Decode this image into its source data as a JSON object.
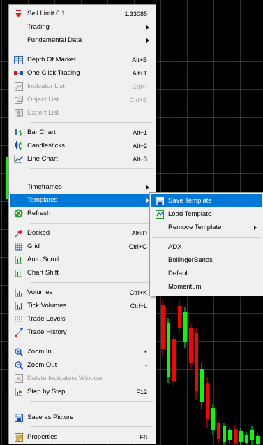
{
  "menu": {
    "sell_limit": {
      "label": "Sell Limit 0.1",
      "price": "1.33085"
    },
    "trading": "Trading",
    "fundamental_data": "Fundamental Data",
    "depth_of_market": {
      "label": "Depth Of Market",
      "shortcut": "Alt+B"
    },
    "one_click_trading": {
      "label": "One Click Trading",
      "shortcut": "Alt+T"
    },
    "indicator_list": {
      "label": "Indicator List",
      "shortcut": "Ctrl+I"
    },
    "object_list": {
      "label": "Object List",
      "shortcut": "Ctrl+B"
    },
    "expert_list": {
      "label": "Expert List"
    },
    "bar_chart": {
      "label": "Bar Chart",
      "shortcut": "Alt+1"
    },
    "candlesticks": {
      "label": "Candlesticks",
      "shortcut": "Alt+2"
    },
    "line_chart": {
      "label": "Line Chart",
      "shortcut": "Alt+3"
    },
    "timeframes": "Timeframes",
    "templates": "Templates",
    "refresh": "Refresh",
    "docked": {
      "label": "Docked",
      "shortcut": "Alt+D"
    },
    "grid": {
      "label": "Grid",
      "shortcut": "Ctrl+G"
    },
    "auto_scroll": {
      "label": "Auto Scroll"
    },
    "chart_shift": {
      "label": "Chart Shift"
    },
    "volumes": {
      "label": "Volumes",
      "shortcut": "Ctrl+K"
    },
    "tick_volumes": {
      "label": "Tick Volumes",
      "shortcut": "Ctrl+L"
    },
    "trade_levels": {
      "label": "Trade Levels"
    },
    "trade_history": {
      "label": "Trade History"
    },
    "zoom_in": {
      "label": "Zoom In",
      "shortcut": "+"
    },
    "zoom_out": {
      "label": "Zoom Out",
      "shortcut": "-"
    },
    "delete_indicators_window": {
      "label": "Delete Indicators Window"
    },
    "step_by_step": {
      "label": "Step by Step",
      "shortcut": "F12"
    },
    "save_as_picture": {
      "label": "Save as Picture"
    },
    "properties": {
      "label": "Properties",
      "shortcut": "F8"
    }
  },
  "templates_submenu": {
    "save_template": "Save Template",
    "load_template": "Load Template",
    "remove_template": "Remove Template",
    "items": [
      "ADX",
      "BollingerBands",
      "Default",
      "Momentum"
    ]
  },
  "colors": {
    "highlight": "#0078d7",
    "menu_bg": "#f0f0f0",
    "bull_candle": "#00ff00",
    "bear_candle": "#ff0000",
    "chart_bg": "#000000"
  }
}
